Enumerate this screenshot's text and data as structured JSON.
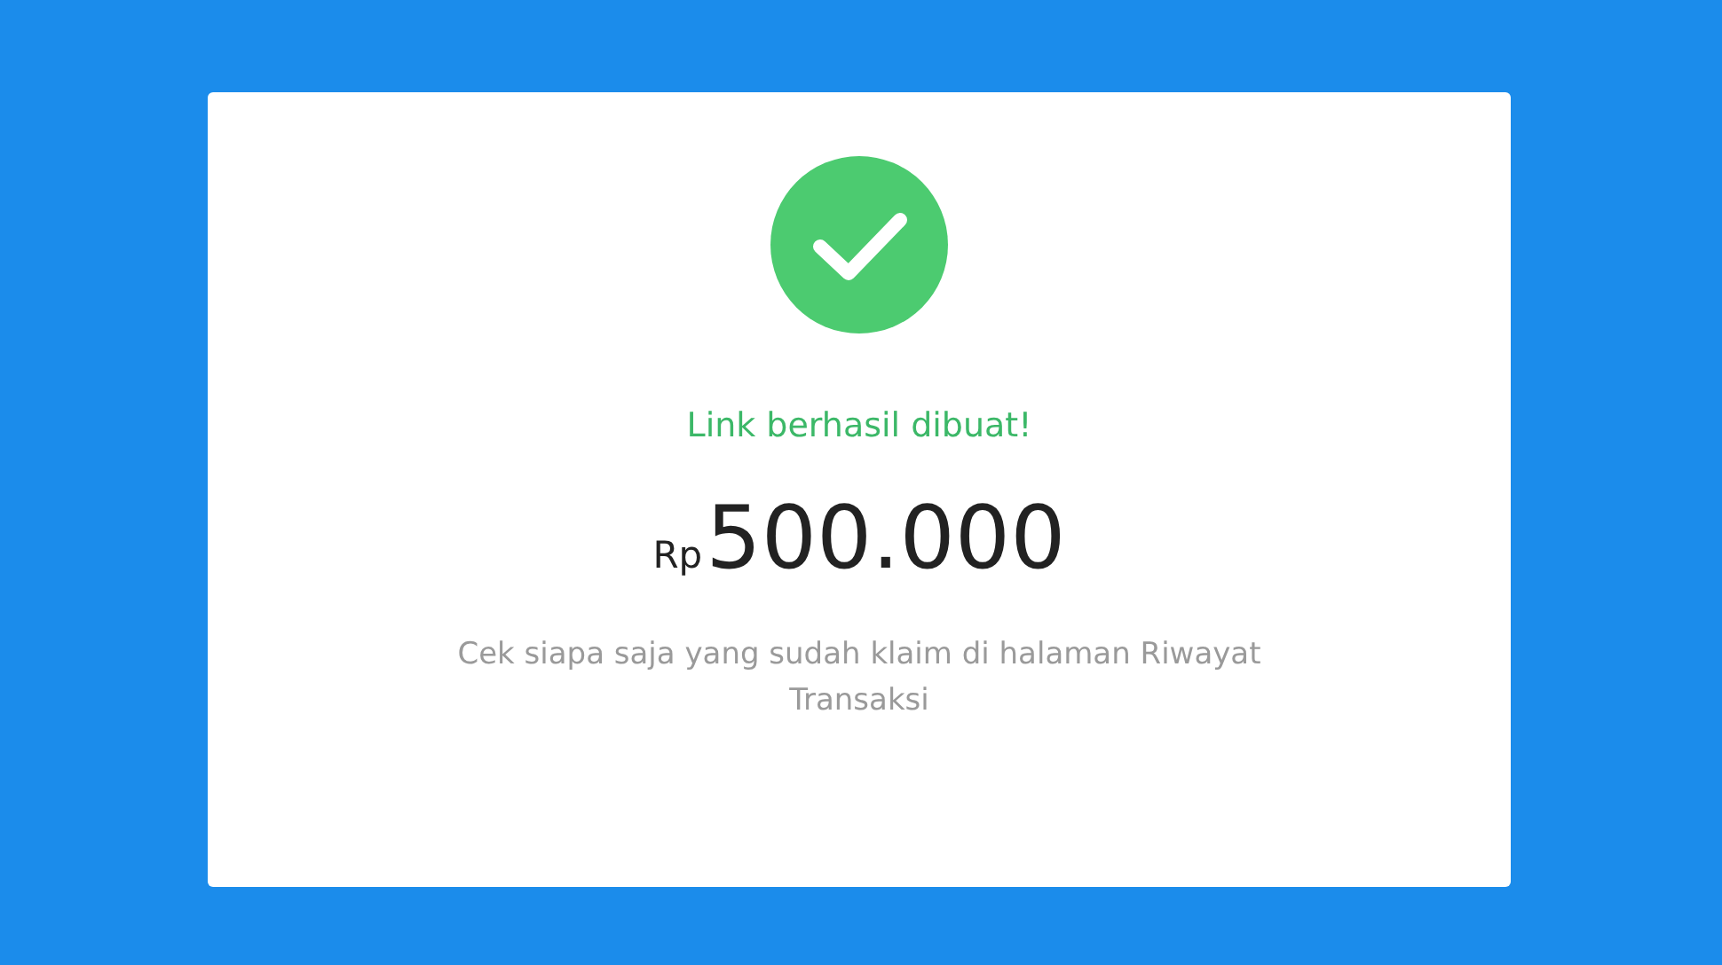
{
  "dialog": {
    "success": true,
    "title": "Link berhasil dibuat!",
    "amount": {
      "currency": "Rp",
      "value": "500.000"
    },
    "description": "Cek siapa saja yang sudah klaim di halaman Riwayat Transaksi"
  }
}
